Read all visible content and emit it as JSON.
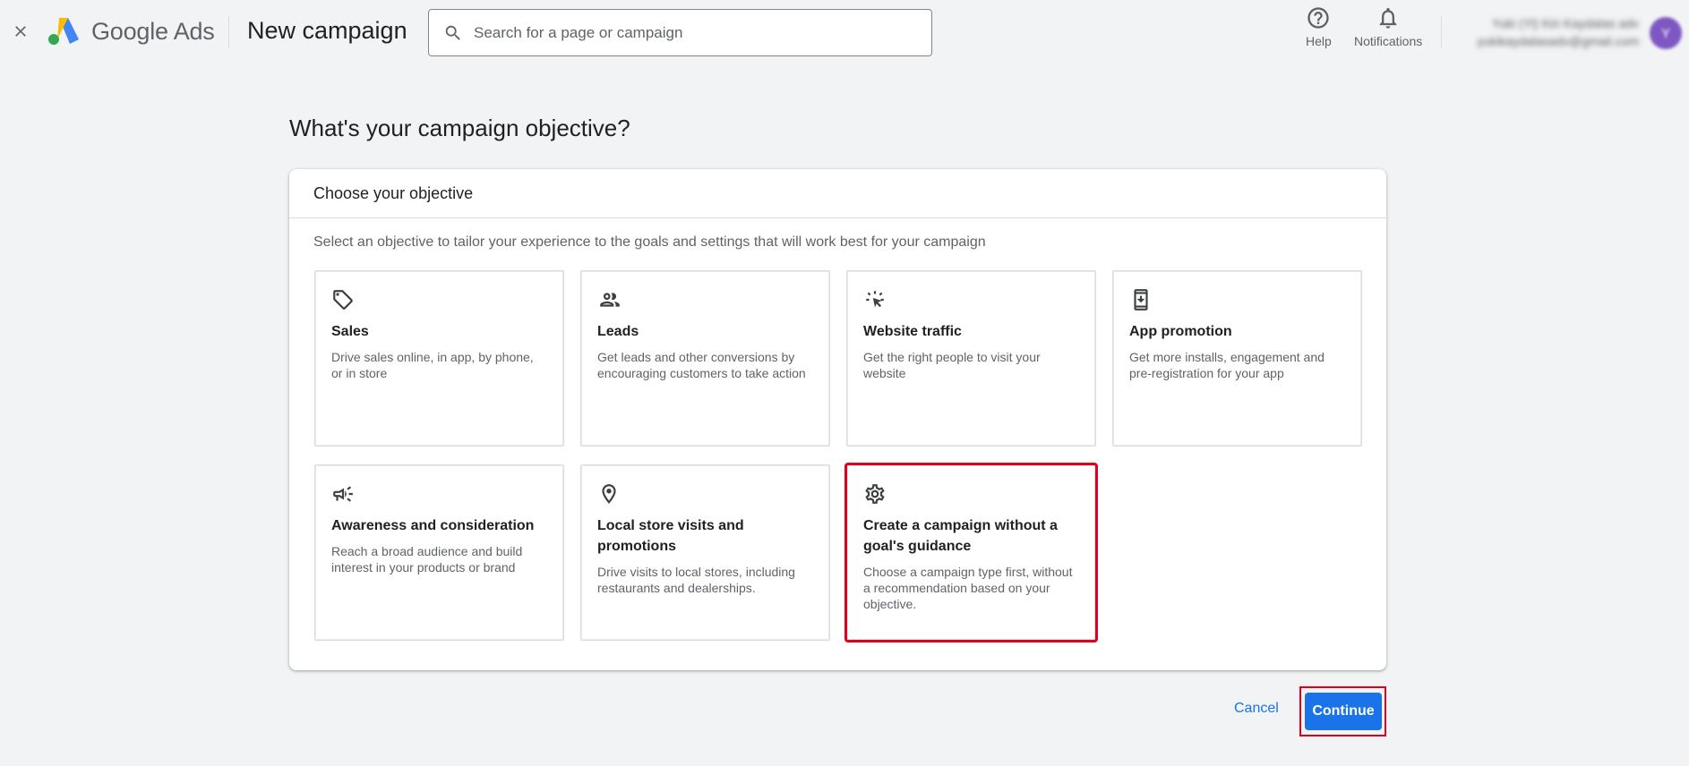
{
  "header": {
    "close_icon": "close-icon",
    "logo_primary": "Google",
    "logo_secondary": "Ads",
    "page_title": "New campaign",
    "search": {
      "placeholder": "Search for a page or campaign",
      "value": ""
    },
    "help_label": "Help",
    "notifications_label": "Notifications",
    "account": {
      "line1": "Yuki (Yl) Kiri Kaydalas adv",
      "line2": "yukikaydalasadv@gmail.com",
      "avatar_letter": "Y"
    }
  },
  "main": {
    "question": "What's your campaign objective?",
    "card_title": "Choose your objective",
    "card_subtitle": "Select an objective to tailor your experience to the goals and settings that will work best for your campaign",
    "objectives": [
      {
        "icon": "tag-icon",
        "title": "Sales",
        "desc": "Drive sales online, in app, by phone, or in store"
      },
      {
        "icon": "people-icon",
        "title": "Leads",
        "desc": "Get leads and other conversions by encouraging customers to take action"
      },
      {
        "icon": "cursor-click-icon",
        "title": "Website traffic",
        "desc": "Get the right people to visit your website"
      },
      {
        "icon": "phone-download-icon",
        "title": "App promotion",
        "desc": "Get more installs, engagement and pre-registration for your app"
      },
      {
        "icon": "megaphone-icon",
        "title": "Awareness and consideration",
        "desc": "Reach a broad audience and build interest in your products or brand"
      },
      {
        "icon": "location-pin-icon",
        "title": "Local store visits and promotions",
        "desc": "Drive visits to local stores, including restaurants and dealerships."
      },
      {
        "icon": "gear-icon",
        "title": "Create a campaign without a goal's guidance",
        "desc": "Choose a campaign type first, without a recommendation based on your objective."
      }
    ],
    "selected_objective": "Create a campaign without a goal's guidance"
  },
  "footer": {
    "cancel_label": "Cancel",
    "continue_label": "Continue"
  },
  "colors": {
    "accent": "#1a73e8",
    "highlight": "#e0001b",
    "background": "#f1f3f4"
  }
}
